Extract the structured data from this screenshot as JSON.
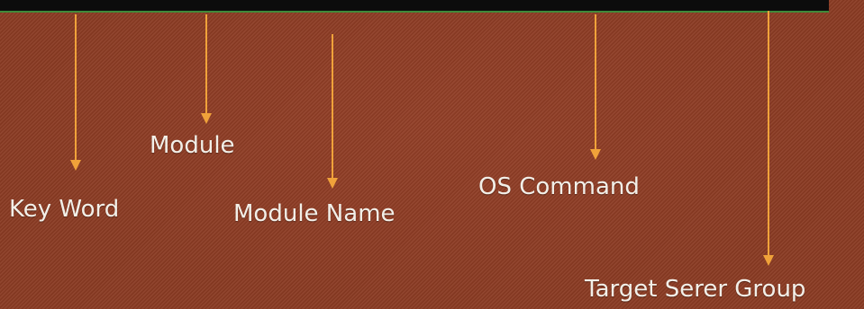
{
  "colors": {
    "background": "#8a3a22",
    "arrow": "#f0a23a",
    "label_text": "#f2efe8",
    "top_bar": "#0c0c0c",
    "top_bar_border": "#3f8a3a"
  },
  "labels": {
    "module": "Module",
    "key_word": "Key Word",
    "module_name": "Module Name",
    "os_command": "OS Command",
    "target_server_group": "Target Serer Group"
  }
}
